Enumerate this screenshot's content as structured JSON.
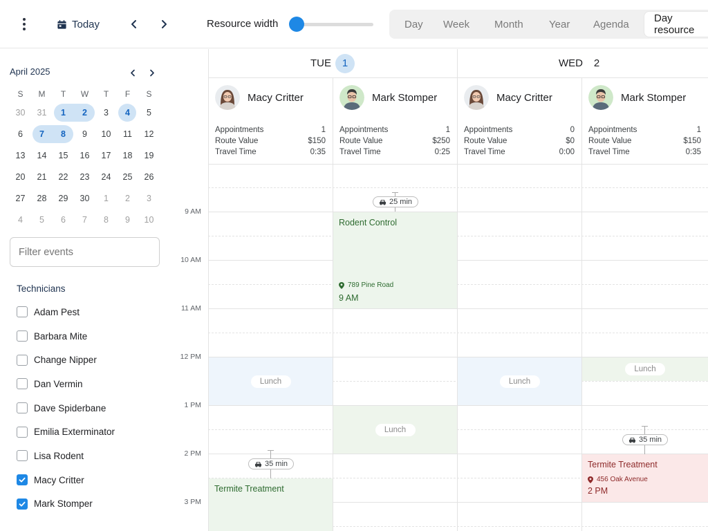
{
  "toolbar": {
    "today_label": "Today",
    "resource_width_label": "Resource width",
    "resource_width_value": 0.0,
    "views": [
      "Day",
      "Week",
      "Month",
      "Year",
      "Agenda",
      "Day resource"
    ],
    "active_view": "Day resource"
  },
  "sidebar": {
    "month_title": "April 2025",
    "weekdays": [
      "S",
      "M",
      "T",
      "W",
      "T",
      "F",
      "S"
    ],
    "weeks": [
      [
        "30",
        "31",
        "1",
        "2",
        "3",
        "4",
        "5"
      ],
      [
        "6",
        "7",
        "8",
        "9",
        "10",
        "11",
        "12"
      ],
      [
        "13",
        "14",
        "15",
        "16",
        "17",
        "18",
        "19"
      ],
      [
        "20",
        "21",
        "22",
        "23",
        "24",
        "25",
        "26"
      ],
      [
        "27",
        "28",
        "29",
        "30",
        "1",
        "2",
        "3"
      ],
      [
        "4",
        "5",
        "6",
        "7",
        "8",
        "9",
        "10"
      ]
    ],
    "filter_placeholder": "Filter events",
    "technicians_title": "Technicians",
    "technicians": [
      {
        "name": "Adam Pest",
        "checked": false
      },
      {
        "name": "Barbara Mite",
        "checked": false
      },
      {
        "name": "Change Nipper",
        "checked": false
      },
      {
        "name": "Dan Vermin",
        "checked": false
      },
      {
        "name": "Dave Spiderbane",
        "checked": false
      },
      {
        "name": "Emilia Exterminator",
        "checked": false
      },
      {
        "name": "Lisa Rodent",
        "checked": false
      },
      {
        "name": "Macy Critter",
        "checked": true
      },
      {
        "name": "Mark Stomper",
        "checked": true
      }
    ]
  },
  "calendar": {
    "days": [
      {
        "dow": "TUE",
        "num": "1",
        "today": true
      },
      {
        "dow": "WED",
        "num": "2",
        "today": false
      }
    ],
    "stat_labels": [
      "Appointments",
      "Route Value",
      "Travel Time"
    ],
    "resources": [
      {
        "name": "Macy Critter",
        "appointments": "1",
        "route_value": "$150",
        "travel_time": "0:35"
      },
      {
        "name": "Mark Stomper",
        "appointments": "1",
        "route_value": "$250",
        "travel_time": "0:25"
      },
      {
        "name": "Macy Critter",
        "appointments": "0",
        "route_value": "$0",
        "travel_time": "0:00"
      },
      {
        "name": "Mark Stomper",
        "appointments": "1",
        "route_value": "$150",
        "travel_time": "0:35"
      }
    ],
    "time_labels": [
      "9 AM",
      "10 AM",
      "11 AM",
      "12 PM",
      "1 PM",
      "2 PM",
      "3 PM"
    ],
    "lunch_label": "Lunch",
    "travel_chips": [
      "25 min",
      "35 min",
      "35 min"
    ],
    "events": [
      {
        "title": "Rodent Control",
        "address": "789 Pine Road",
        "time": "9 AM"
      },
      {
        "title": "Termite Treatment",
        "address": "456 Oak Avenue",
        "time": "2 PM"
      },
      {
        "title": "Termite Treatment",
        "address": "",
        "time": ""
      }
    ]
  },
  "colors": {
    "accent": "#1e88e5",
    "today_highlight": "#cfe3f5",
    "lunch_blue": "#eef5fc",
    "lunch_green": "#eef5ec",
    "event_green": "#edf5ec",
    "event_red": "#fbe8e8"
  }
}
